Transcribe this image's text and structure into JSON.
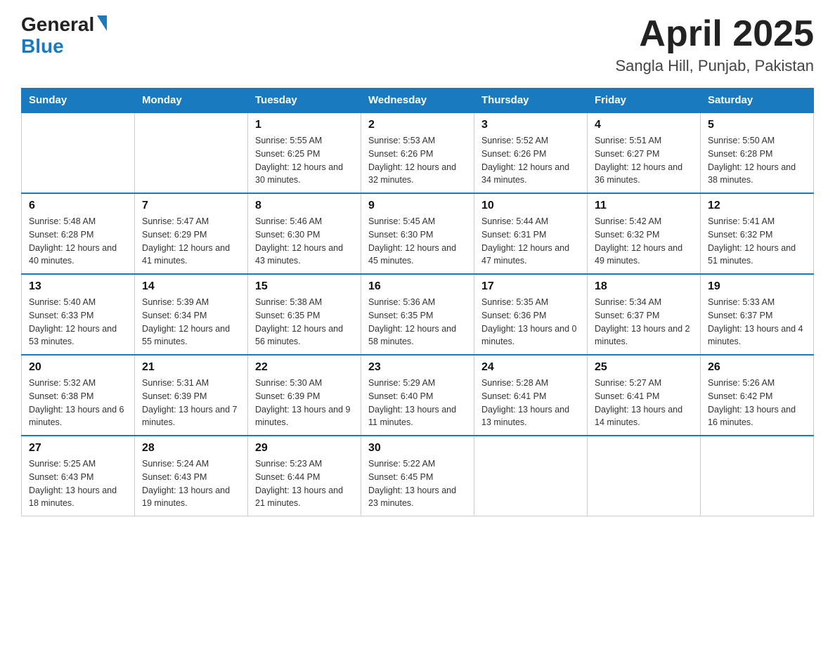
{
  "header": {
    "logo_general": "General",
    "logo_blue": "Blue",
    "title": "April 2025",
    "subtitle": "Sangla Hill, Punjab, Pakistan"
  },
  "columns": [
    "Sunday",
    "Monday",
    "Tuesday",
    "Wednesday",
    "Thursday",
    "Friday",
    "Saturday"
  ],
  "weeks": [
    [
      {
        "day": "",
        "detail": ""
      },
      {
        "day": "",
        "detail": ""
      },
      {
        "day": "1",
        "detail": "Sunrise: 5:55 AM\nSunset: 6:25 PM\nDaylight: 12 hours\nand 30 minutes."
      },
      {
        "day": "2",
        "detail": "Sunrise: 5:53 AM\nSunset: 6:26 PM\nDaylight: 12 hours\nand 32 minutes."
      },
      {
        "day": "3",
        "detail": "Sunrise: 5:52 AM\nSunset: 6:26 PM\nDaylight: 12 hours\nand 34 minutes."
      },
      {
        "day": "4",
        "detail": "Sunrise: 5:51 AM\nSunset: 6:27 PM\nDaylight: 12 hours\nand 36 minutes."
      },
      {
        "day": "5",
        "detail": "Sunrise: 5:50 AM\nSunset: 6:28 PM\nDaylight: 12 hours\nand 38 minutes."
      }
    ],
    [
      {
        "day": "6",
        "detail": "Sunrise: 5:48 AM\nSunset: 6:28 PM\nDaylight: 12 hours\nand 40 minutes."
      },
      {
        "day": "7",
        "detail": "Sunrise: 5:47 AM\nSunset: 6:29 PM\nDaylight: 12 hours\nand 41 minutes."
      },
      {
        "day": "8",
        "detail": "Sunrise: 5:46 AM\nSunset: 6:30 PM\nDaylight: 12 hours\nand 43 minutes."
      },
      {
        "day": "9",
        "detail": "Sunrise: 5:45 AM\nSunset: 6:30 PM\nDaylight: 12 hours\nand 45 minutes."
      },
      {
        "day": "10",
        "detail": "Sunrise: 5:44 AM\nSunset: 6:31 PM\nDaylight: 12 hours\nand 47 minutes."
      },
      {
        "day": "11",
        "detail": "Sunrise: 5:42 AM\nSunset: 6:32 PM\nDaylight: 12 hours\nand 49 minutes."
      },
      {
        "day": "12",
        "detail": "Sunrise: 5:41 AM\nSunset: 6:32 PM\nDaylight: 12 hours\nand 51 minutes."
      }
    ],
    [
      {
        "day": "13",
        "detail": "Sunrise: 5:40 AM\nSunset: 6:33 PM\nDaylight: 12 hours\nand 53 minutes."
      },
      {
        "day": "14",
        "detail": "Sunrise: 5:39 AM\nSunset: 6:34 PM\nDaylight: 12 hours\nand 55 minutes."
      },
      {
        "day": "15",
        "detail": "Sunrise: 5:38 AM\nSunset: 6:35 PM\nDaylight: 12 hours\nand 56 minutes."
      },
      {
        "day": "16",
        "detail": "Sunrise: 5:36 AM\nSunset: 6:35 PM\nDaylight: 12 hours\nand 58 minutes."
      },
      {
        "day": "17",
        "detail": "Sunrise: 5:35 AM\nSunset: 6:36 PM\nDaylight: 13 hours\nand 0 minutes."
      },
      {
        "day": "18",
        "detail": "Sunrise: 5:34 AM\nSunset: 6:37 PM\nDaylight: 13 hours\nand 2 minutes."
      },
      {
        "day": "19",
        "detail": "Sunrise: 5:33 AM\nSunset: 6:37 PM\nDaylight: 13 hours\nand 4 minutes."
      }
    ],
    [
      {
        "day": "20",
        "detail": "Sunrise: 5:32 AM\nSunset: 6:38 PM\nDaylight: 13 hours\nand 6 minutes."
      },
      {
        "day": "21",
        "detail": "Sunrise: 5:31 AM\nSunset: 6:39 PM\nDaylight: 13 hours\nand 7 minutes."
      },
      {
        "day": "22",
        "detail": "Sunrise: 5:30 AM\nSunset: 6:39 PM\nDaylight: 13 hours\nand 9 minutes."
      },
      {
        "day": "23",
        "detail": "Sunrise: 5:29 AM\nSunset: 6:40 PM\nDaylight: 13 hours\nand 11 minutes."
      },
      {
        "day": "24",
        "detail": "Sunrise: 5:28 AM\nSunset: 6:41 PM\nDaylight: 13 hours\nand 13 minutes."
      },
      {
        "day": "25",
        "detail": "Sunrise: 5:27 AM\nSunset: 6:41 PM\nDaylight: 13 hours\nand 14 minutes."
      },
      {
        "day": "26",
        "detail": "Sunrise: 5:26 AM\nSunset: 6:42 PM\nDaylight: 13 hours\nand 16 minutes."
      }
    ],
    [
      {
        "day": "27",
        "detail": "Sunrise: 5:25 AM\nSunset: 6:43 PM\nDaylight: 13 hours\nand 18 minutes."
      },
      {
        "day": "28",
        "detail": "Sunrise: 5:24 AM\nSunset: 6:43 PM\nDaylight: 13 hours\nand 19 minutes."
      },
      {
        "day": "29",
        "detail": "Sunrise: 5:23 AM\nSunset: 6:44 PM\nDaylight: 13 hours\nand 21 minutes."
      },
      {
        "day": "30",
        "detail": "Sunrise: 5:22 AM\nSunset: 6:45 PM\nDaylight: 13 hours\nand 23 minutes."
      },
      {
        "day": "",
        "detail": ""
      },
      {
        "day": "",
        "detail": ""
      },
      {
        "day": "",
        "detail": ""
      }
    ]
  ]
}
